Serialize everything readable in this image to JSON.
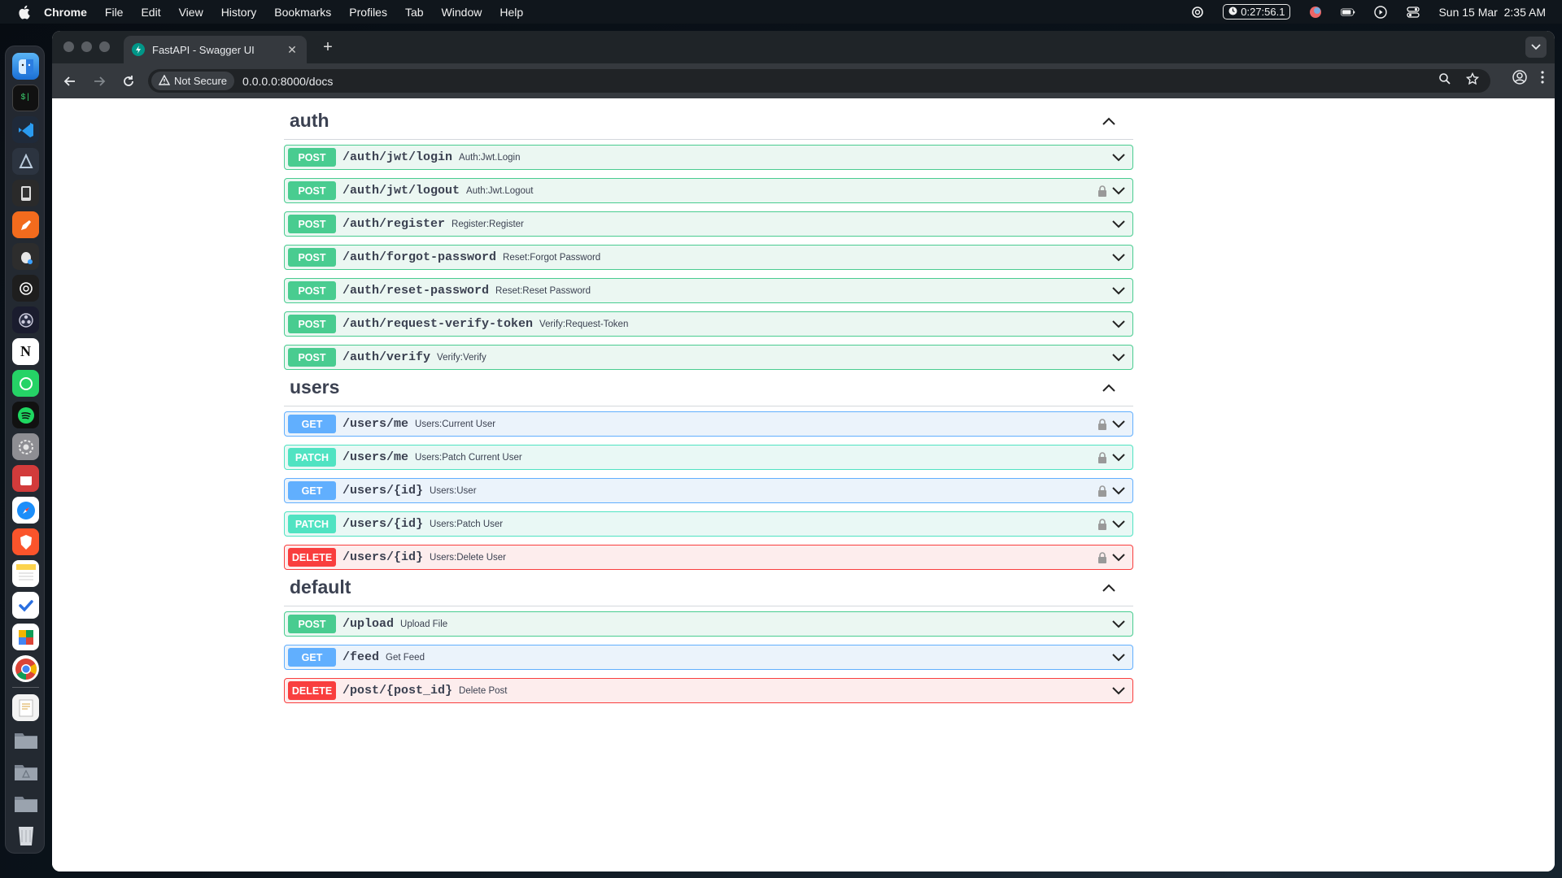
{
  "menubar": {
    "app": "Chrome",
    "items": [
      "File",
      "Edit",
      "View",
      "History",
      "Bookmarks",
      "Profiles",
      "Tab",
      "Window",
      "Help"
    ],
    "timer": "0:27:56.1",
    "datetime": "Sun 15 Mar  2:35 AM"
  },
  "browser": {
    "tab_title": "FastAPI - Swagger UI",
    "security_label": "Not Secure",
    "url": "0.0.0.0:8000/docs"
  },
  "colors": {
    "post": "#49cc90",
    "get": "#61affe",
    "patch": "#50e3c2",
    "delete": "#f93e3e"
  },
  "sections": [
    {
      "name": "auth",
      "operations": [
        {
          "method": "POST",
          "path": "/auth/jwt/login",
          "summary": "Auth:Jwt.Login",
          "locked": false
        },
        {
          "method": "POST",
          "path": "/auth/jwt/logout",
          "summary": "Auth:Jwt.Logout",
          "locked": true
        },
        {
          "method": "POST",
          "path": "/auth/register",
          "summary": "Register:Register",
          "locked": false
        },
        {
          "method": "POST",
          "path": "/auth/forgot-password",
          "summary": "Reset:Forgot Password",
          "locked": false
        },
        {
          "method": "POST",
          "path": "/auth/reset-password",
          "summary": "Reset:Reset Password",
          "locked": false
        },
        {
          "method": "POST",
          "path": "/auth/request-verify-token",
          "summary": "Verify:Request-Token",
          "locked": false
        },
        {
          "method": "POST",
          "path": "/auth/verify",
          "summary": "Verify:Verify",
          "locked": false
        }
      ]
    },
    {
      "name": "users",
      "operations": [
        {
          "method": "GET",
          "path": "/users/me",
          "summary": "Users:Current User",
          "locked": true
        },
        {
          "method": "PATCH",
          "path": "/users/me",
          "summary": "Users:Patch Current User",
          "locked": true
        },
        {
          "method": "GET",
          "path": "/users/{id}",
          "summary": "Users:User",
          "locked": true
        },
        {
          "method": "PATCH",
          "path": "/users/{id}",
          "summary": "Users:Patch User",
          "locked": true
        },
        {
          "method": "DELETE",
          "path": "/users/{id}",
          "summary": "Users:Delete User",
          "locked": true
        }
      ]
    },
    {
      "name": "default",
      "operations": [
        {
          "method": "POST",
          "path": "/upload",
          "summary": "Upload File",
          "locked": false
        },
        {
          "method": "GET",
          "path": "/feed",
          "summary": "Get Feed",
          "locked": false
        },
        {
          "method": "DELETE",
          "path": "/post/{post_id}",
          "summary": "Delete Post",
          "locked": false
        }
      ]
    }
  ],
  "dock": {
    "apps": [
      "finder-icon",
      "terminal-icon",
      "vscode-icon",
      "xcode-instruments-icon",
      "simulator-icon",
      "pen-app-icon",
      "sequel-icon",
      "chatgpt-icon",
      "obs-icon",
      "notion-icon",
      "whatsapp-icon",
      "spotify-icon",
      "system-settings-icon",
      "calendar-app-icon",
      "safari-icon",
      "brave-icon",
      "notes-icon",
      "tasks-icon",
      "sheets-icon",
      "chrome-icon"
    ],
    "folders": [
      "document-stack-icon",
      "folder-icon",
      "applications-folder-icon",
      "downloads-folder-icon",
      "trash-icon"
    ]
  }
}
